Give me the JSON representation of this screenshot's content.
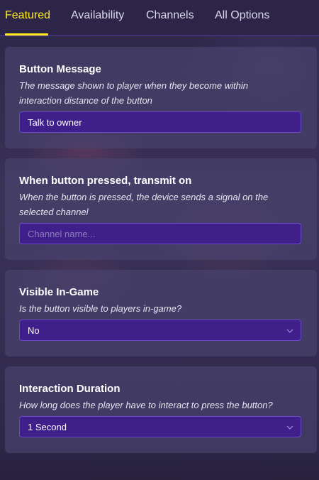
{
  "tabs": [
    {
      "label": "Featured",
      "active": true
    },
    {
      "label": "Availability",
      "active": false
    },
    {
      "label": "Channels",
      "active": false
    },
    {
      "label": "All Options",
      "active": false
    }
  ],
  "cards": {
    "button_message": {
      "title": "Button Message",
      "description": "The message shown to player when they become within interaction distance of the button",
      "value": "Talk to owner"
    },
    "transmit_on": {
      "title": "When button pressed, transmit on",
      "description": "When the button is pressed, the device sends a signal on the selected channel",
      "placeholder": "Channel name..."
    },
    "visible_in_game": {
      "title": "Visible In-Game",
      "description": "Is the button visible to players in-game?",
      "selected": "No"
    },
    "interaction_duration": {
      "title": "Interaction Duration",
      "description": "How long does the player have to interact to press the button?",
      "selected": "1 Second"
    }
  },
  "colors": {
    "accent": "#ffee1a",
    "field_bg": "#3f1f8a",
    "field_border": "#6a48c8",
    "card_bg": "#48426e"
  },
  "icons": {
    "dropdown": "chevron-down-icon"
  }
}
